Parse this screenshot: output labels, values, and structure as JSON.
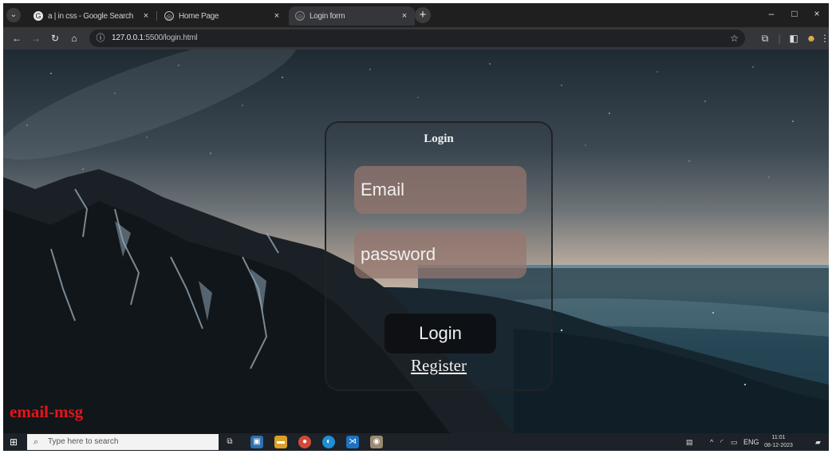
{
  "browser": {
    "tabs": [
      {
        "title": "a | in css - Google Search",
        "active": false
      },
      {
        "title": "Home Page",
        "active": false
      },
      {
        "title": "Login form",
        "active": true
      }
    ],
    "new_tab": "+",
    "window_controls": {
      "minimize": "–",
      "maximize": "□",
      "close": "×"
    },
    "url_host": "127.0.0.1",
    "url_path": ":5500/login.html"
  },
  "login": {
    "title": "Login",
    "email_placeholder": "Email",
    "password_placeholder": "password",
    "login_button": "Login",
    "register_link": "Register"
  },
  "email_msg": "email-msg",
  "taskbar": {
    "search_placeholder": "Type here to search",
    "language": "ENG",
    "time": "11:01",
    "date": "08-12-2023"
  },
  "colors": {
    "email_msg": "#e2151c",
    "field_fill": "#96766e",
    "tab_strip": "#1f1f1f"
  }
}
